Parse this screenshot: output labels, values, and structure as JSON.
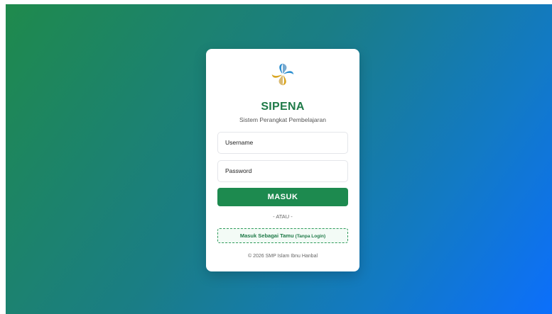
{
  "login": {
    "title": "SIPENA",
    "subtitle": "Sistem Perangkat Pembelajaran",
    "username_placeholder": "Username",
    "password_placeholder": "Password",
    "submit_label": "MASUK",
    "divider_text": "- ATAU -",
    "guest_label": "Masuk Sebagai Tamu",
    "guest_note": "(Tanpa Login)",
    "footer": "© 2026 SMP Islam Ibnu Hanbal"
  },
  "colors": {
    "brand_green": "#1d8a4f",
    "gradient_start": "#1f8a4c",
    "gradient_end": "#0c6ffc"
  },
  "icons": {
    "logo": "sipena-logo-icon"
  }
}
